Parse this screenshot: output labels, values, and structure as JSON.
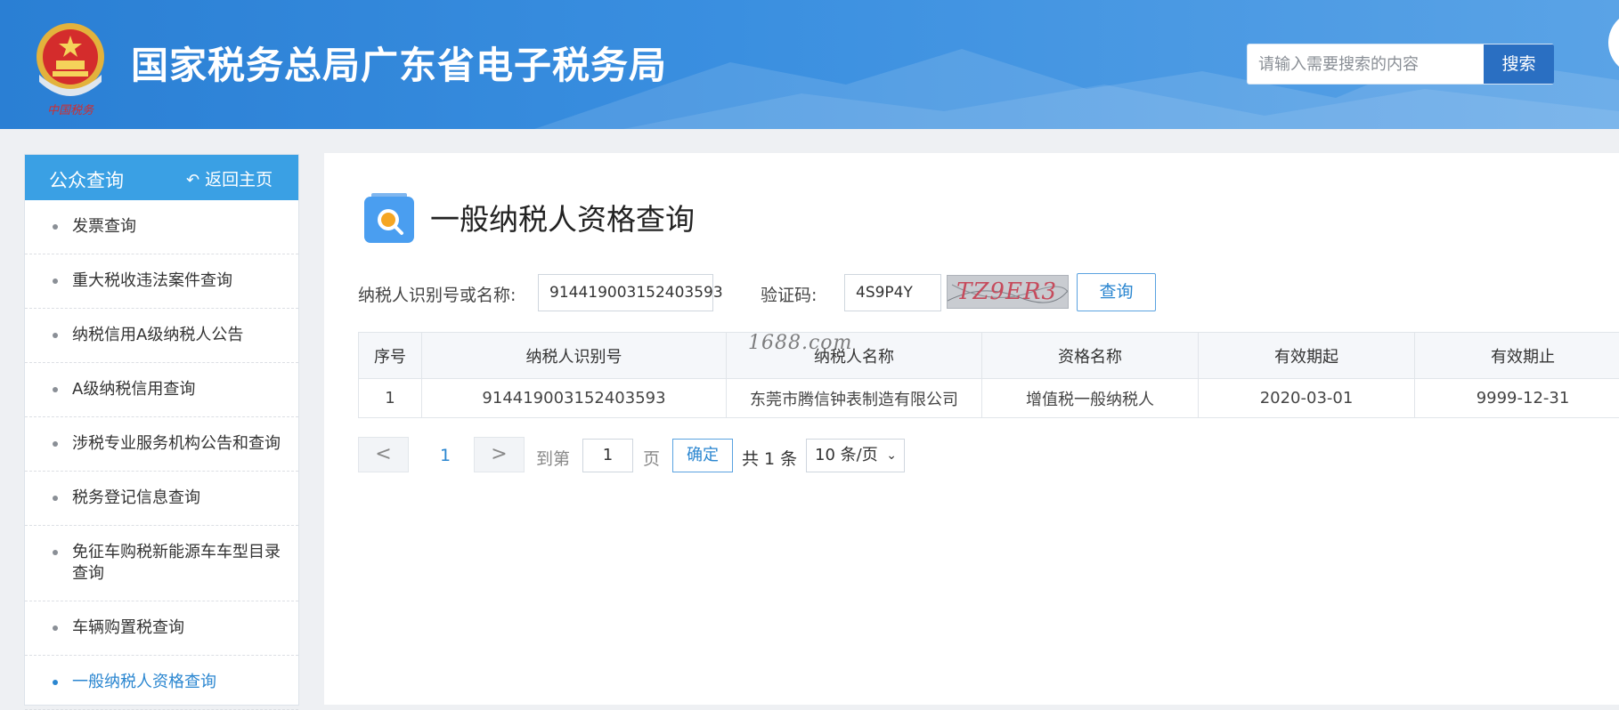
{
  "header": {
    "title": "国家税务总局广东省电子税务局",
    "emblem_caption": "中国税务",
    "search_placeholder": "请输入需要搜索的内容",
    "search_button": "搜索"
  },
  "sidebar": {
    "title": "公众查询",
    "back_label": "返回主页",
    "items": [
      {
        "label": "发票查询"
      },
      {
        "label": "重大税收违法案件查询"
      },
      {
        "label": "纳税信用A级纳税人公告"
      },
      {
        "label": "A级纳税信用查询"
      },
      {
        "label": "涉税专业服务机构公告和查询"
      },
      {
        "label": "税务登记信息查询"
      },
      {
        "label": "免征车购税新能源车车型目录查询"
      },
      {
        "label": "车辆购置税查询"
      },
      {
        "label": "一般纳税人资格查询",
        "active": true
      }
    ]
  },
  "main": {
    "page_title": "一般纳税人资格查询",
    "form": {
      "taxpayer_label": "纳税人识别号或名称:",
      "taxpayer_value": "914419003152403593",
      "captcha_label": "验证码:",
      "captcha_value": "4S9P4Y",
      "captcha_image_text": "TZ9ER3",
      "query_button": "查询"
    },
    "watermark": "1688.com",
    "table": {
      "headers": [
        "序号",
        "纳税人识别号",
        "纳税人名称",
        "资格名称",
        "有效期起",
        "有效期止"
      ],
      "rows": [
        [
          "1",
          "914419003152403593",
          "东莞市腾信钟表制造有限公司",
          "增值税一般纳税人",
          "2020-03-01",
          "9999-12-31"
        ]
      ]
    },
    "pagination": {
      "prev": "<",
      "current_page": "1",
      "next": ">",
      "goto_label": "到第",
      "goto_value": "1",
      "page_unit": "页",
      "confirm": "确定",
      "total": "共 1 条",
      "page_size": "10 条/页"
    }
  },
  "colors": {
    "header_blue": "#2a7fd4",
    "sidebar_head": "#3aa0e4",
    "accent": "#2a86d0"
  }
}
